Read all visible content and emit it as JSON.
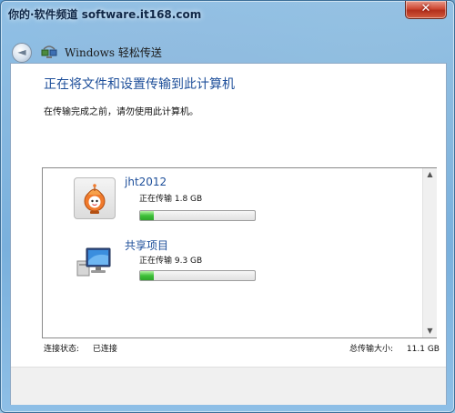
{
  "watermark_title": "你的·软件频道 software.it168.com",
  "window": {
    "close_glyph": "✕",
    "back_glyph": "◄",
    "app_icon": "transfer-icon",
    "app_title": "Windows 轻松传送"
  },
  "content": {
    "heading": "正在将文件和设置传输到此计算机",
    "subtext": "在传输完成之前，请勿使用此计算机。"
  },
  "transfers": [
    {
      "name": "jht2012",
      "status": "正在传输  1.8 GB",
      "icon": "user-avatar-icon",
      "progress": 0.12
    },
    {
      "name": "共享项目",
      "status": "正在传输  9.3 GB",
      "icon": "computer-icon",
      "progress": 0.12
    }
  ],
  "footer": {
    "connection_label": "连接状态:",
    "connection_value": "已连接",
    "total_label": "总传输大小:",
    "total_value": "11.1 GB"
  },
  "colors": {
    "heading": "#1e4f9a",
    "progress": "#3ec13a",
    "close": "#cf4a34"
  }
}
